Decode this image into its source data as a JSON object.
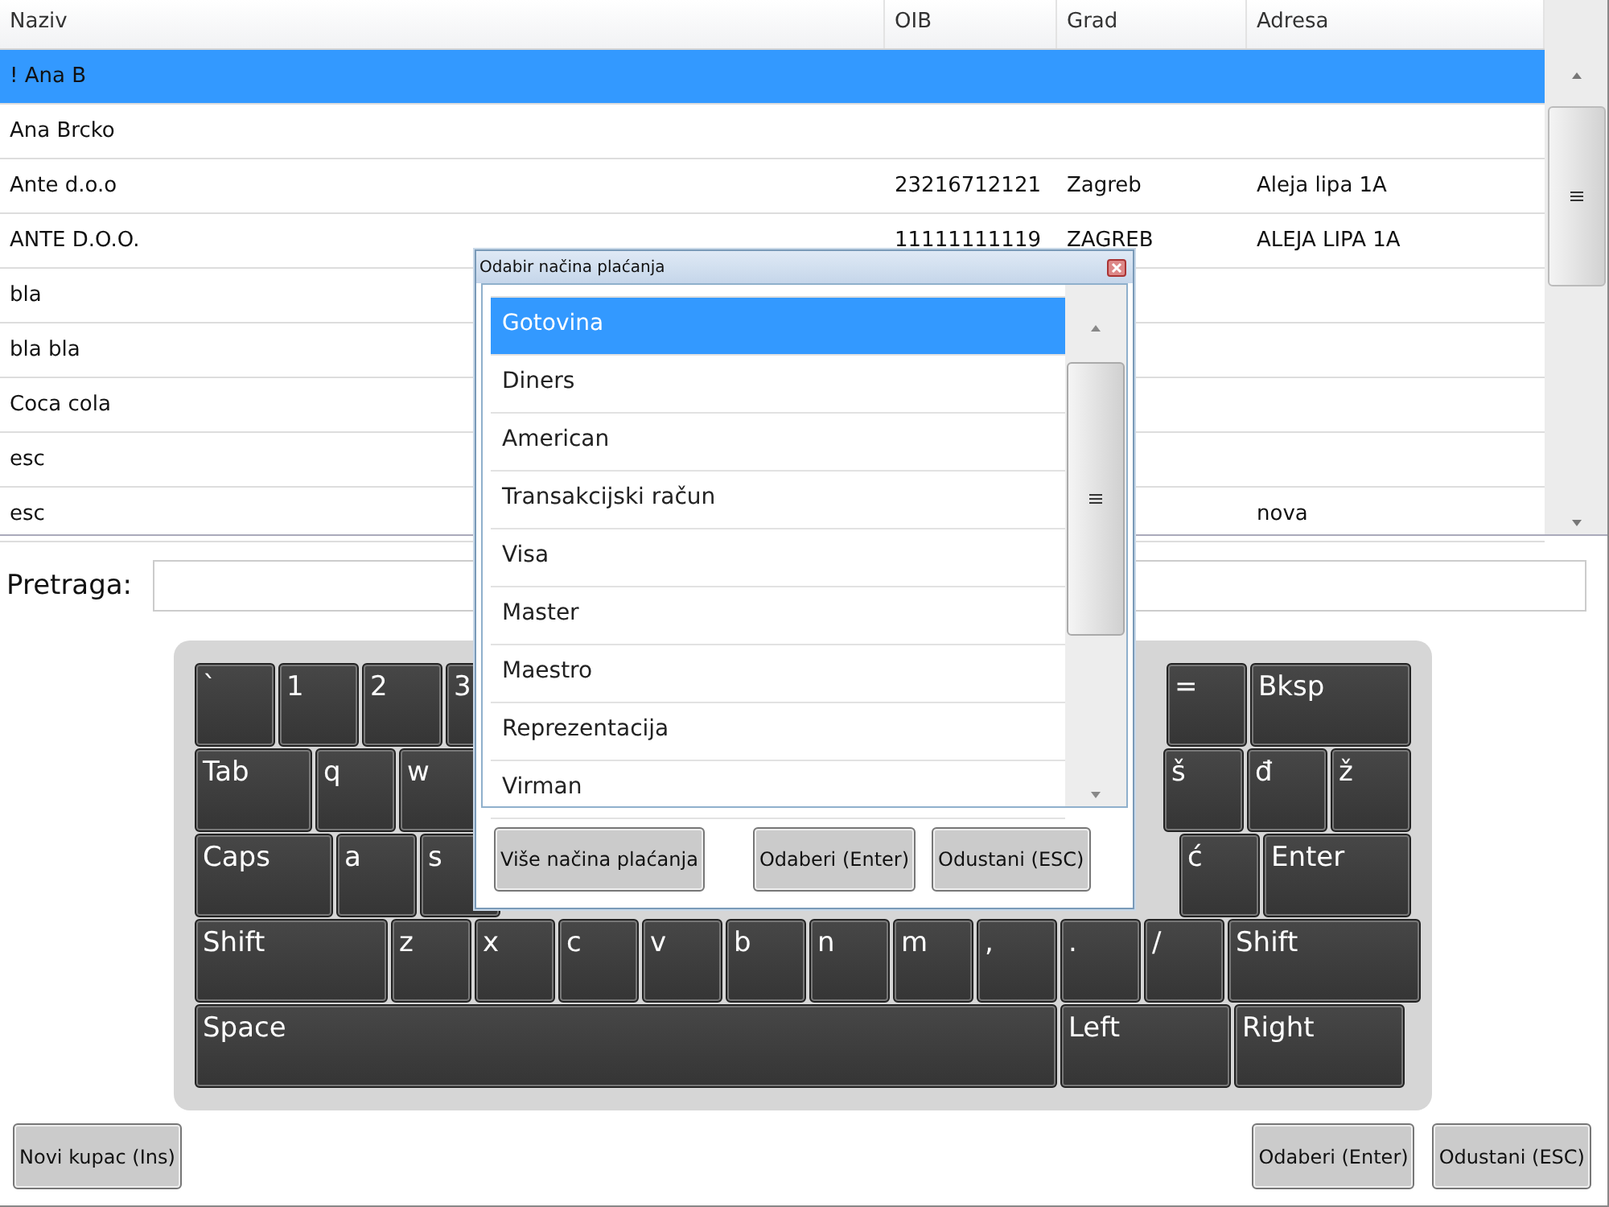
{
  "table": {
    "columns": [
      "Naziv",
      "OIB",
      "Grad",
      "Adresa"
    ],
    "rows": [
      {
        "naziv": "! Ana B",
        "selected": true
      },
      {
        "naziv": "Ana Brcko",
        "selected": false
      },
      {
        "naziv": "Ante d.o.o",
        "oib": "23216712121",
        "grad": "Zagreb",
        "adresa": "Aleja lipa 1A",
        "selected": false
      },
      {
        "naziv": "ANTE D.O.O.",
        "oib": "11111111119",
        "grad": "ZAGREB",
        "adresa": "ALEJA LIPA 1A",
        "selected": false
      },
      {
        "naziv": "bla",
        "selected": false
      },
      {
        "naziv": "bla bla",
        "selected": false
      },
      {
        "naziv": "Coca cola",
        "selected": false
      },
      {
        "naziv": "esc",
        "selected": false
      },
      {
        "naziv": "esc",
        "adresa": "nova",
        "selected": false
      }
    ]
  },
  "search": {
    "label": "Pretraga:"
  },
  "keyboard": [
    {
      "left": [
        {
          "label": "`",
          "kind": "char"
        },
        {
          "label": "1",
          "kind": "char"
        },
        {
          "label": "2",
          "kind": "char"
        },
        {
          "label": "3",
          "kind": "char"
        }
      ],
      "right": [
        {
          "label": "=",
          "kind": "char"
        },
        {
          "label": "Bksp",
          "kind": "bksp"
        }
      ]
    },
    {
      "left": [
        {
          "label": "Tab",
          "kind": "tab"
        },
        {
          "label": "q",
          "kind": "char"
        },
        {
          "label": "w",
          "kind": "char"
        }
      ],
      "right": [
        {
          "label": "š",
          "kind": "char"
        },
        {
          "label": "đ",
          "kind": "char"
        },
        {
          "label": "ž",
          "kind": "char"
        }
      ]
    },
    {
      "left": [
        {
          "label": "Caps",
          "kind": "caps"
        },
        {
          "label": "a",
          "kind": "char"
        },
        {
          "label": "s",
          "kind": "char"
        }
      ],
      "right": [
        {
          "label": "ć",
          "kind": "char"
        },
        {
          "label": "Enter",
          "kind": "enter"
        }
      ]
    },
    {
      "left": [
        {
          "label": "Shift",
          "kind": "shift"
        },
        {
          "label": "z",
          "kind": "char"
        },
        {
          "label": "x",
          "kind": "char"
        },
        {
          "label": "c",
          "kind": "char"
        },
        {
          "label": "v",
          "kind": "char"
        },
        {
          "label": "b",
          "kind": "char"
        },
        {
          "label": "n",
          "kind": "char"
        },
        {
          "label": "m",
          "kind": "char"
        },
        {
          "label": ",",
          "kind": "char"
        },
        {
          "label": ".",
          "kind": "char"
        },
        {
          "label": "/",
          "kind": "char"
        },
        {
          "label": "Shift",
          "kind": "shift"
        }
      ]
    },
    {
      "left": [
        {
          "label": "Space",
          "kind": "space"
        },
        {
          "label": "Left",
          "kind": "arrow"
        },
        {
          "label": "Right",
          "kind": "arrow"
        }
      ]
    }
  ],
  "buttons": {
    "left": [
      "Novi kupac (Ins)"
    ],
    "right": [
      "Odaberi (Enter)",
      "Odustani (ESC)"
    ]
  },
  "dialog": {
    "title": "Odabir načina plaćanja",
    "items": [
      {
        "label": "Gotovina",
        "selected": true
      },
      {
        "label": "Diners",
        "selected": false
      },
      {
        "label": "American",
        "selected": false
      },
      {
        "label": "Transakcijski račun",
        "selected": false
      },
      {
        "label": "Visa",
        "selected": false
      },
      {
        "label": "Master",
        "selected": false
      },
      {
        "label": "Maestro",
        "selected": false
      },
      {
        "label": "Reprezentacija",
        "selected": false
      },
      {
        "label": "Virman",
        "selected": false
      }
    ],
    "buttons": [
      "Više načina plaćanja",
      "Odaberi (Enter)",
      "Odustani (ESC)"
    ]
  }
}
